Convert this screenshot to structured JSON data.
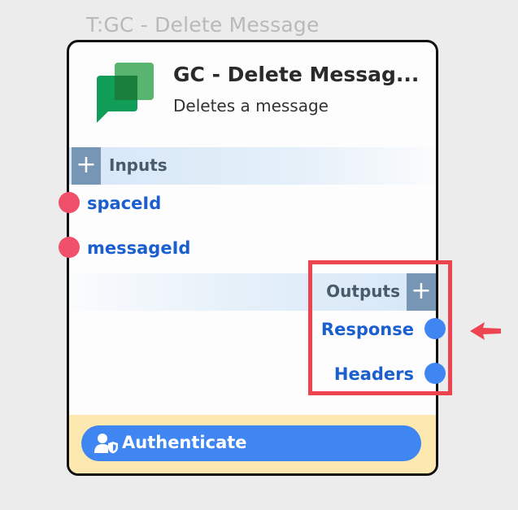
{
  "canvas_label": "T:GC - Delete Message",
  "node": {
    "app_icon": "google-chat-icon",
    "title": "GC - Delete Messag...",
    "subtitle": "Deletes a message",
    "inputs": {
      "section_label": "Inputs",
      "add_icon": "plus-icon",
      "ports": [
        {
          "label": "spaceId"
        },
        {
          "label": "messageId"
        }
      ]
    },
    "outputs": {
      "section_label": "Outputs",
      "add_icon": "plus-icon",
      "ports": [
        {
          "label": "Response"
        },
        {
          "label": "Headers"
        }
      ]
    },
    "auth": {
      "label": "Authenticate",
      "icon": "user-shield-icon"
    }
  },
  "colors": {
    "input_port": "#f0506a",
    "output_port": "#3f86f2",
    "port_label": "#1b5fcf",
    "highlight": "#ec4550",
    "auth_bg": "#fde8b0",
    "auth_button": "#3f86f2"
  },
  "annotation": {
    "highlight": "outputs-highlight-box",
    "arrow_icon": "arrow-left-icon"
  }
}
